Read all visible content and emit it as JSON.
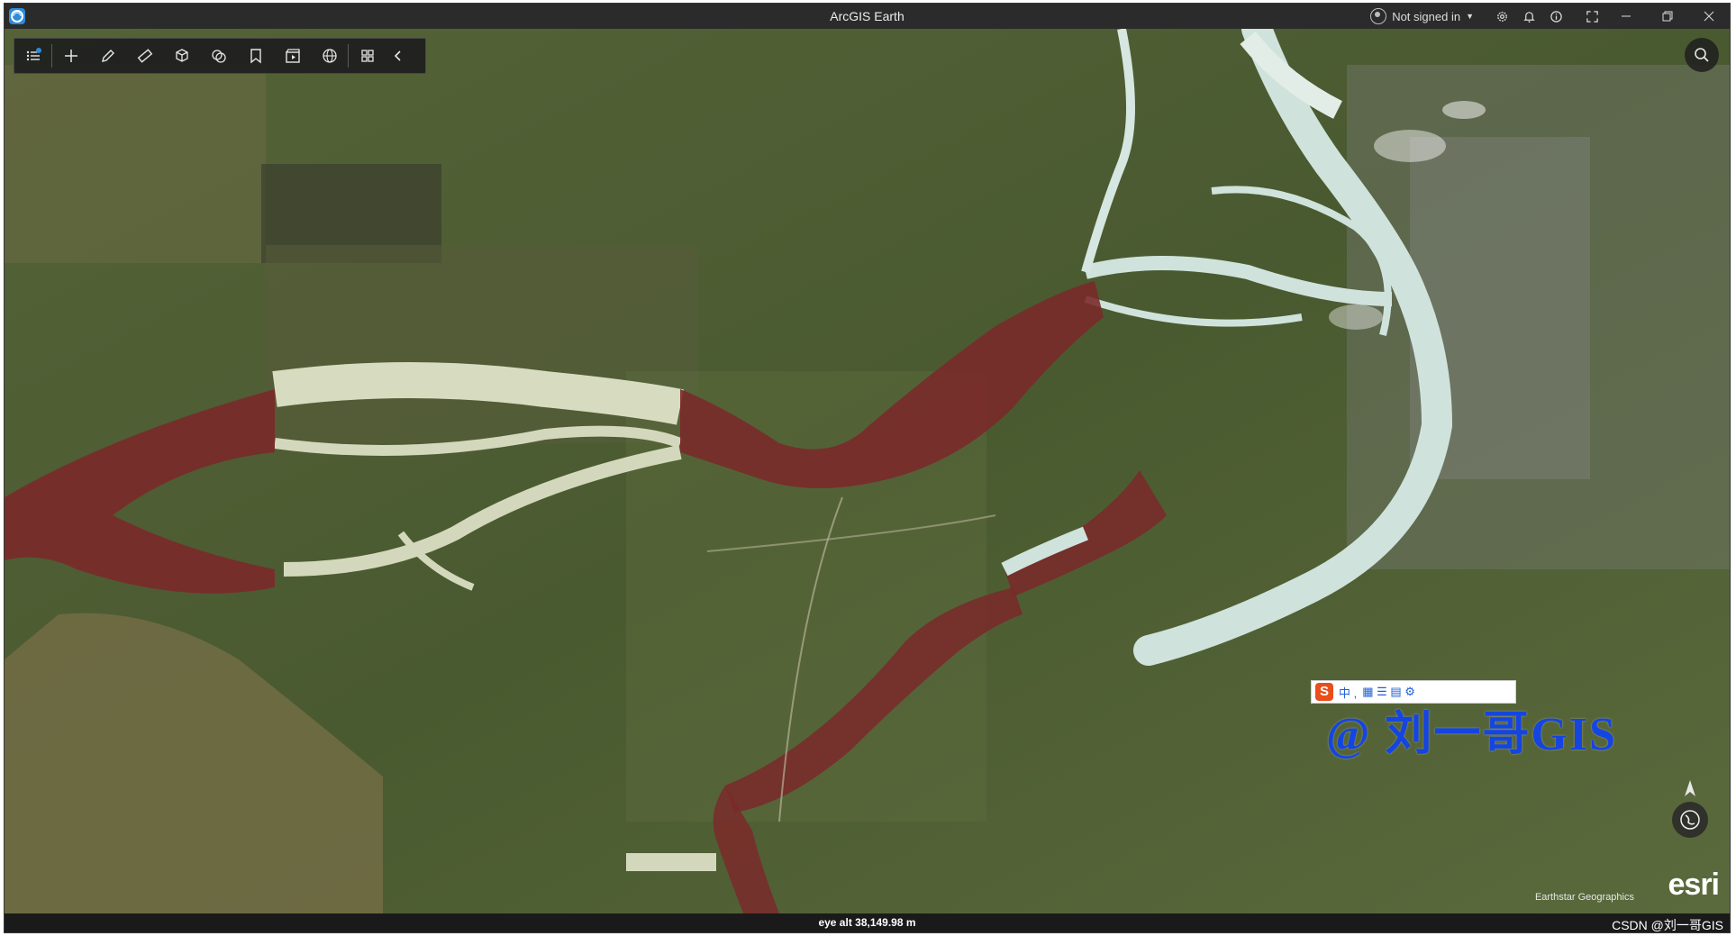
{
  "window": {
    "title": "ArcGIS Earth",
    "signin_label": "Not signed in"
  },
  "toolbar": {
    "items": [
      {
        "name": "layers",
        "icon": "layers-icon"
      },
      {
        "name": "add",
        "icon": "plus-icon"
      },
      {
        "name": "draw",
        "icon": "pencil-icon"
      },
      {
        "name": "measure",
        "icon": "ruler-icon"
      },
      {
        "name": "3d-analysis",
        "icon": "cube-icon"
      },
      {
        "name": "overlay",
        "icon": "layered-circles-icon"
      },
      {
        "name": "bookmarks",
        "icon": "bookmark-icon"
      },
      {
        "name": "tour",
        "icon": "clapperboard-icon"
      },
      {
        "name": "basemap",
        "icon": "globe-icon"
      },
      {
        "name": "more",
        "icon": "grid-icon"
      },
      {
        "name": "collapse",
        "icon": "chevron-left-icon"
      }
    ]
  },
  "status": {
    "eye_alt": "eye alt 38,149.98 m"
  },
  "map": {
    "attribution": "Earthstar Geographics",
    "logo_text": "esri"
  },
  "watermarks": {
    "ime_chars": "中 ,",
    "overlay_text": "@ 刘一哥GIS",
    "csdn": "CSDN @刘一哥GIS"
  },
  "colors": {
    "titlebar": "#2b2b2b",
    "accent": "#2f8ad8",
    "flood_layer": "#7a2a2a",
    "river_ice": "#cfe3dc"
  }
}
